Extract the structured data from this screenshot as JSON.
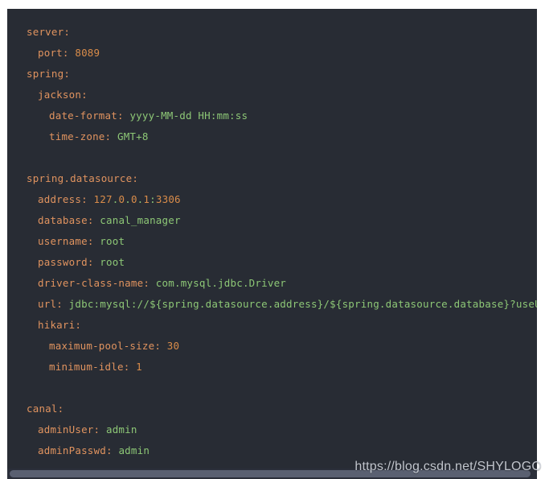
{
  "editor": {
    "language": "yaml",
    "background_color": "#282c34",
    "key_color": "#e0935f",
    "string_color": "#8dc776",
    "number_color": "#d98c4a",
    "scrollbar_track_color": "#2b2f3a",
    "scrollbar_thumb_color": "#5a6071",
    "truncated_right": true
  },
  "watermark": {
    "text": "https://blog.csdn.net/SHYLOGO"
  },
  "code": {
    "lines": [
      {
        "indent": 0,
        "tokens": [
          {
            "t": "server",
            "c": "key"
          },
          {
            "t": ":",
            "c": "punct"
          }
        ]
      },
      {
        "indent": 1,
        "tokens": [
          {
            "t": "port",
            "c": "key"
          },
          {
            "t": ": ",
            "c": "punct"
          },
          {
            "t": "8089",
            "c": "num"
          }
        ]
      },
      {
        "indent": 0,
        "tokens": [
          {
            "t": "spring",
            "c": "key"
          },
          {
            "t": ":",
            "c": "punct"
          }
        ]
      },
      {
        "indent": 1,
        "tokens": [
          {
            "t": "jackson",
            "c": "key"
          },
          {
            "t": ":",
            "c": "punct"
          }
        ]
      },
      {
        "indent": 2,
        "tokens": [
          {
            "t": "date-format",
            "c": "key"
          },
          {
            "t": ": ",
            "c": "punct"
          },
          {
            "t": "yyyy-MM-dd HH:mm:ss",
            "c": "str"
          }
        ]
      },
      {
        "indent": 2,
        "tokens": [
          {
            "t": "time-zone",
            "c": "key"
          },
          {
            "t": ": ",
            "c": "punct"
          },
          {
            "t": "GMT+8",
            "c": "str"
          }
        ]
      },
      {
        "indent": 0,
        "tokens": []
      },
      {
        "indent": 0,
        "tokens": [
          {
            "t": "spring.datasource",
            "c": "key"
          },
          {
            "t": ":",
            "c": "punct"
          }
        ]
      },
      {
        "indent": 1,
        "tokens": [
          {
            "t": "address",
            "c": "key"
          },
          {
            "t": ": ",
            "c": "punct"
          },
          {
            "t": "127",
            "c": "num"
          },
          {
            "t": ".",
            "c": "str"
          },
          {
            "t": "0",
            "c": "num"
          },
          {
            "t": ".",
            "c": "str"
          },
          {
            "t": "0",
            "c": "num"
          },
          {
            "t": ".",
            "c": "str"
          },
          {
            "t": "1",
            "c": "num"
          },
          {
            "t": ":",
            "c": "str"
          },
          {
            "t": "3306",
            "c": "num"
          }
        ]
      },
      {
        "indent": 1,
        "tokens": [
          {
            "t": "database",
            "c": "key"
          },
          {
            "t": ": ",
            "c": "punct"
          },
          {
            "t": "canal_manager",
            "c": "str"
          }
        ]
      },
      {
        "indent": 1,
        "tokens": [
          {
            "t": "username",
            "c": "key"
          },
          {
            "t": ": ",
            "c": "punct"
          },
          {
            "t": "root",
            "c": "str"
          }
        ]
      },
      {
        "indent": 1,
        "tokens": [
          {
            "t": "password",
            "c": "key"
          },
          {
            "t": ": ",
            "c": "punct"
          },
          {
            "t": "root",
            "c": "str"
          }
        ]
      },
      {
        "indent": 1,
        "tokens": [
          {
            "t": "driver-class-name",
            "c": "key"
          },
          {
            "t": ": ",
            "c": "punct"
          },
          {
            "t": "com.mysql.jdbc.Driver",
            "c": "str"
          }
        ]
      },
      {
        "indent": 1,
        "tokens": [
          {
            "t": "url",
            "c": "key"
          },
          {
            "t": ": ",
            "c": "punct"
          },
          {
            "t": "jdbc:mysql://${spring.datasource.address}/${spring.datasource.database}?useUnicode=true&ch",
            "c": "str"
          }
        ]
      },
      {
        "indent": 1,
        "tokens": [
          {
            "t": "hikari",
            "c": "key"
          },
          {
            "t": ":",
            "c": "punct"
          }
        ]
      },
      {
        "indent": 2,
        "tokens": [
          {
            "t": "maximum-pool-size",
            "c": "key"
          },
          {
            "t": ": ",
            "c": "punct"
          },
          {
            "t": "30",
            "c": "num"
          }
        ]
      },
      {
        "indent": 2,
        "tokens": [
          {
            "t": "minimum-idle",
            "c": "key"
          },
          {
            "t": ": ",
            "c": "punct"
          },
          {
            "t": "1",
            "c": "num"
          }
        ]
      },
      {
        "indent": 0,
        "tokens": []
      },
      {
        "indent": 0,
        "tokens": [
          {
            "t": "canal",
            "c": "key"
          },
          {
            "t": ":",
            "c": "punct"
          }
        ]
      },
      {
        "indent": 1,
        "tokens": [
          {
            "t": "adminUser",
            "c": "key"
          },
          {
            "t": ": ",
            "c": "punct"
          },
          {
            "t": "admin",
            "c": "str"
          }
        ]
      },
      {
        "indent": 1,
        "tokens": [
          {
            "t": "adminPasswd",
            "c": "key"
          },
          {
            "t": ": ",
            "c": "punct"
          },
          {
            "t": "admin",
            "c": "str"
          }
        ]
      }
    ]
  }
}
